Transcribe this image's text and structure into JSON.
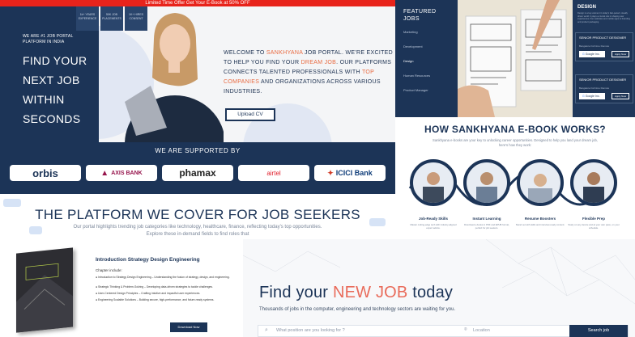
{
  "hero": {
    "promo": "Limited Time Offer Get Your E-Book at 50% OFF",
    "tagline": [
      "WE ARE #1 JOB PORTAL",
      "PLATFORM IN INDIA"
    ],
    "headline": [
      "FIND YOUR",
      "NEXT JOB",
      "WITHIN",
      "SECONDS"
    ],
    "stats": [
      "1k+ YEARS EXPERIENCE",
      "50K JOB PLACEMENTS",
      "1K+ HIRES CONSENT"
    ],
    "intro_pre": "WELCOME TO ",
    "intro_brand": "SANKHYANA",
    "intro_mid": " JOB PORTAL. WE'RE EXCITED TO HELP YOU FIND YOUR ",
    "intro_dream": "DREAM JOB",
    "intro_mid2": ". OUR PLATFORMS CONNECTS TALENTED PROFESSIONALS WITH ",
    "intro_top": "TOP COMPANIES",
    "intro_end": " AND ORGANIZATIONS ACROSS VARIOUS INDUSTRIES.",
    "upload_label": "Upload CV"
  },
  "sponsors": {
    "title": "WE ARE SUPPORTED BY",
    "logos": [
      "orbis",
      "AXIS BANK",
      "phamax",
      "airtel",
      "ICICI Bank"
    ]
  },
  "featured": {
    "title": [
      "FEATURED",
      "JOBS"
    ],
    "items": [
      "Marketing",
      "Development",
      "Design",
      "Human Resources",
      "Product Manager"
    ],
    "right_title": "DESIGN",
    "right_desc": "Design is a key element in today's fast-paced, visually driven world. It plays a crucial role in shaping user experiences, from websites and mobile apps to branding and product packaging.",
    "jobs": [
      {
        "title": "SENIOR PRODUCT DESIGNER",
        "meta": "Bangalore  Full time  Remote",
        "company": "Google Inc.",
        "apply": "Apply Now"
      },
      {
        "title": "SENIOR PRODUCT DESIGNER",
        "meta": "Bangalore  Full time  Remote",
        "company": "Google Inc.",
        "apply": "Apply Now"
      }
    ]
  },
  "how": {
    "title": "HOW SANKHYANA E-BOOK WORKS?",
    "subtitle": "Sankhyana e-books are your key to unlocking career opportunities. Designed to help you land your dream job, here's how they work:",
    "steps": [
      {
        "title": "Job-Ready Skills",
        "desc": "Master cutting-edge tech with industry-aligned expert advice."
      },
      {
        "title": "Instant Learning",
        "desc": "Download e-books in PDF and EPUB format, perfect for job seekers."
      },
      {
        "title": "Resume Boosters",
        "desc": "Stand out with skills and interview-ready content."
      },
      {
        "title": "Flexible Prep",
        "desc": "Study on any device and at your own pace, on your schedule."
      }
    ]
  },
  "platform": {
    "title": "THE PLATFORM WE COVER FOR JOB SEEKERS",
    "subtitle": "Our portal highlights trending job categories like technology, healthcare, finance, reflecting today's top opportunities. Explore these in-demand fields to find roles that"
  },
  "ebook": {
    "title": "Introduction Strategy Design Engineering",
    "chapter_label": "Chapter include:",
    "items": [
      "Introduction to Strategy Design Engineering – Understanding the fusion of strategy, design, and engineering.",
      "Strategic Thinking & Problem-Solving – Developing data-driven strategies to tackle challenges.",
      "User-Centered Design Principles – Crafting intuitive and impactful user experiences.",
      "Engineering Scalable Solutions – Building secure, high-performance, and future-ready systems."
    ],
    "download_label": "Download Now"
  },
  "find": {
    "title_pre": "Find your ",
    "title_hl": "NEW JOB",
    "title_post": " today",
    "subtitle": "Thousands of jobs in the computer, engineering and technology sectors are waiting for you.",
    "search_placeholder": "What position are you looking for ?",
    "location_placeholder": "Location",
    "search_button": "Search job"
  }
}
